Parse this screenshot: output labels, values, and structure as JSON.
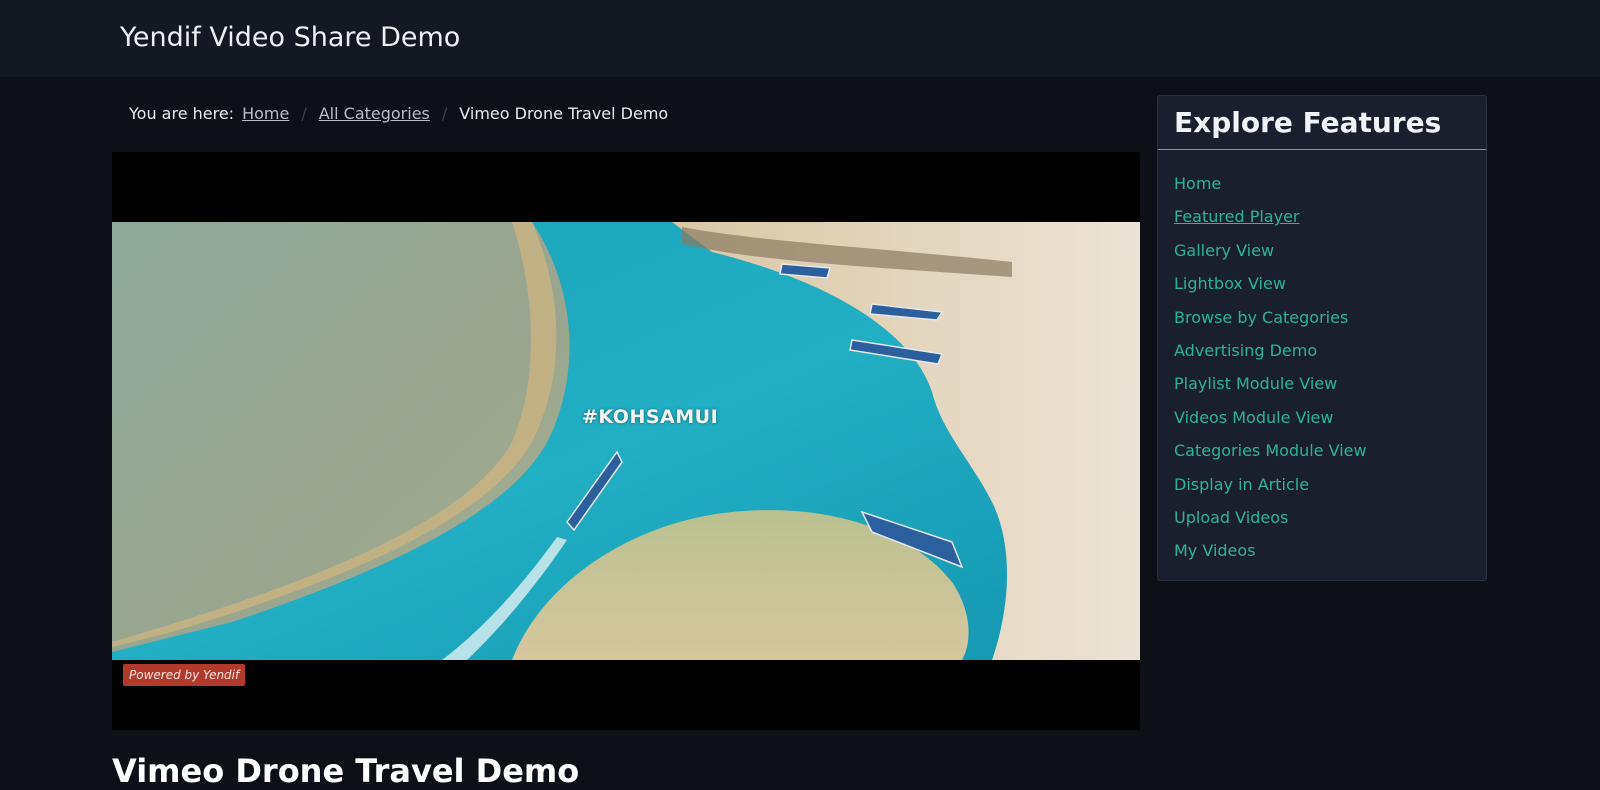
{
  "site": {
    "title": "Yendif Video Share Demo"
  },
  "breadcrumb": {
    "prefix": "You are here:",
    "items": [
      "Home",
      "All Categories"
    ],
    "current": "Vimeo Drone Travel Demo"
  },
  "player": {
    "caption": "#KOHSAMUI",
    "badge": "Powered by Yendif"
  },
  "page": {
    "heading": "Vimeo Drone Travel Demo"
  },
  "sidebar": {
    "title": "Explore Features",
    "items": [
      {
        "label": "Home"
      },
      {
        "label": "Featured Player"
      },
      {
        "label": "Gallery View"
      },
      {
        "label": "Lightbox View"
      },
      {
        "label": "Browse by Categories"
      },
      {
        "label": "Advertising Demo"
      },
      {
        "label": "Playlist Module View"
      },
      {
        "label": "Videos Module View"
      },
      {
        "label": "Categories Module View"
      },
      {
        "label": "Display in Article"
      },
      {
        "label": "Upload Videos"
      },
      {
        "label": "My Videos"
      }
    ],
    "active_index": 1
  },
  "colors": {
    "accent": "#2bb39a",
    "badge": "#b23a2b",
    "background": "#0d1017",
    "panel": "#1a1f2e"
  }
}
